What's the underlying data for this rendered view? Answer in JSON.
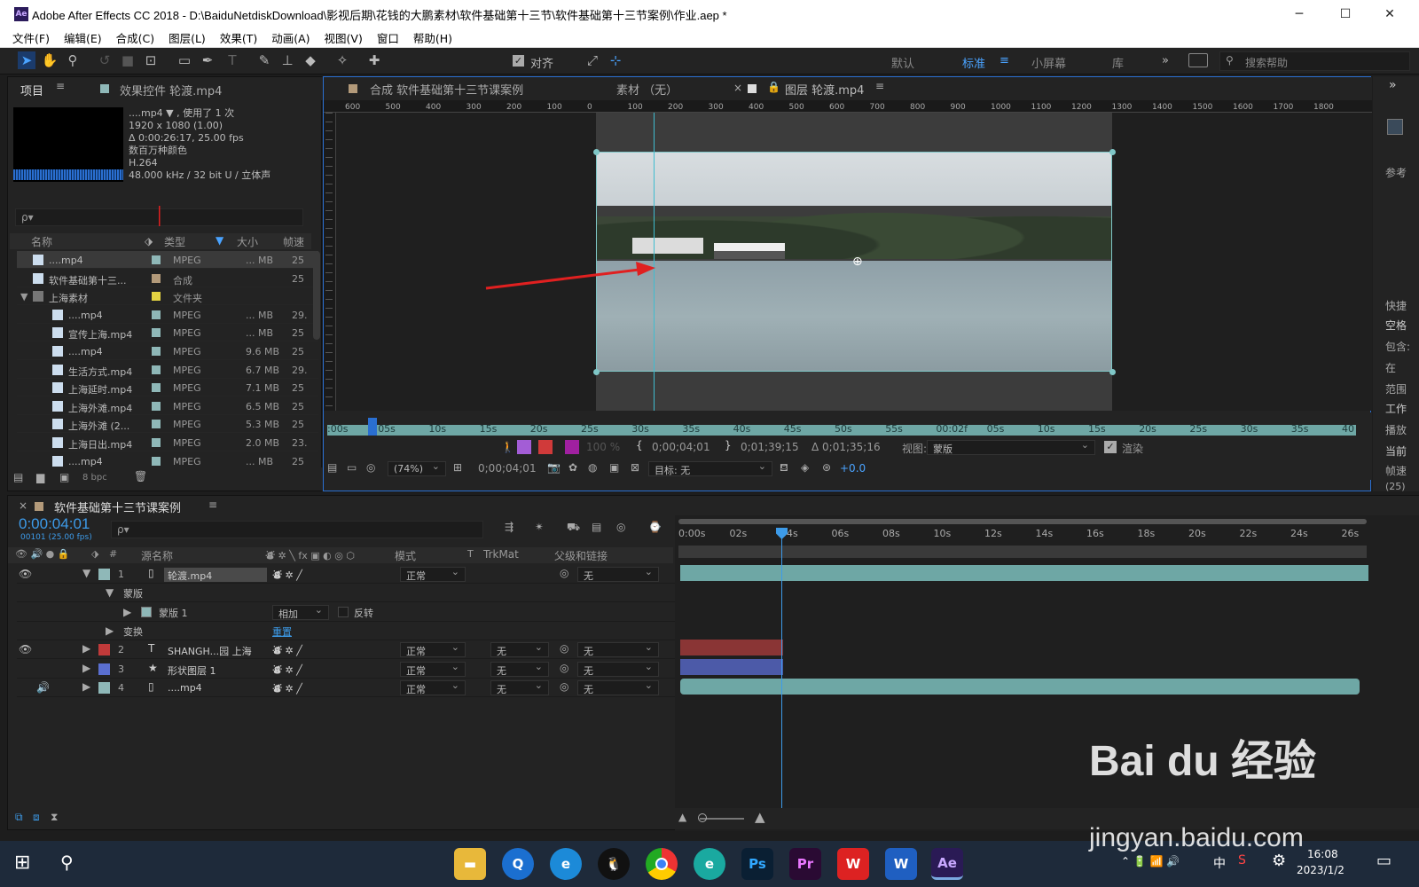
{
  "app": {
    "title": "Adobe After Effects CC 2018 - D:\\BaiduNetdiskDownload\\影视后期\\花钱的大鹏素材\\软件基础第十三节\\软件基础第十三节案例\\作业.aep *",
    "badge": "Ae",
    "win_min": "─",
    "win_max": "☐",
    "win_close": "✕"
  },
  "menu": [
    "文件(F)",
    "编辑(E)",
    "合成(C)",
    "图层(L)",
    "效果(T)",
    "动画(A)",
    "视图(V)",
    "窗口",
    "帮助(H)"
  ],
  "toolbar": {
    "align_label": "对齐",
    "workspaces": [
      "默认",
      "标准",
      "小屏幕",
      "库"
    ],
    "search_placeholder": "搜索帮助",
    "more": "»"
  },
  "project": {
    "tab": "项目",
    "effects_tab": "效果控件 轮渡.mp4",
    "info": {
      "name": "....mp4 ▼ , 使用了 1 次",
      "res": "1920 x 1080 (1.00)",
      "dur": "Δ 0:00:26:17, 25.00 fps",
      "colors": "数百万种颜色",
      "codec": "H.264",
      "audio": "48.000 kHz / 32 bit U / 立体声"
    },
    "search_placeholder": "ρ▾",
    "columns": [
      "名称",
      "类型",
      "大小",
      "帧速率"
    ],
    "bpc": "8 bpc",
    "items": [
      {
        "name": "....mp4",
        "type": "MPEG",
        "size": "... MB",
        "fps": "25",
        "color": "#8fb8b8",
        "indent": 0,
        "selected": true
      },
      {
        "name": "软件基础第十三...",
        "type": "合成",
        "size": "",
        "fps": "25",
        "color": "#b39a7a",
        "indent": 0
      },
      {
        "name": "上海素材",
        "type": "文件夹",
        "size": "",
        "fps": "",
        "color": "#e5d442",
        "indent": 0,
        "folder": true
      },
      {
        "name": "....mp4",
        "type": "MPEG",
        "size": "... MB",
        "fps": "29.",
        "color": "#8fb8b8",
        "indent": 1
      },
      {
        "name": "宣传上海.mp4",
        "type": "MPEG",
        "size": "... MB",
        "fps": "25",
        "color": "#8fb8b8",
        "indent": 1
      },
      {
        "name": "....mp4",
        "type": "MPEG",
        "size": "9.6 MB",
        "fps": "25",
        "color": "#8fb8b8",
        "indent": 1
      },
      {
        "name": "生活方式.mp4",
        "type": "MPEG",
        "size": "6.7 MB",
        "fps": "29.",
        "color": "#8fb8b8",
        "indent": 1
      },
      {
        "name": "上海延时.mp4",
        "type": "MPEG",
        "size": "7.1 MB",
        "fps": "25",
        "color": "#8fb8b8",
        "indent": 1
      },
      {
        "name": "上海外滩.mp4",
        "type": "MPEG",
        "size": "6.5 MB",
        "fps": "25",
        "color": "#8fb8b8",
        "indent": 1
      },
      {
        "name": "上海外滩 (2...",
        "type": "MPEG",
        "size": "5.3 MB",
        "fps": "25",
        "color": "#8fb8b8",
        "indent": 1
      },
      {
        "name": "上海日出.mp4",
        "type": "MPEG",
        "size": "2.0 MB",
        "fps": "23.",
        "color": "#8fb8b8",
        "indent": 1
      },
      {
        "name": "....mp4",
        "type": "MPEG",
        "size": "... MB",
        "fps": "25",
        "color": "#8fb8b8",
        "indent": 1
      }
    ]
  },
  "viewer": {
    "tabs": [
      "合成 软件基础第十三节课案例",
      "素材 （无）",
      "图层 轮渡.mp4"
    ],
    "ruler": [
      "600",
      "500",
      "400",
      "300",
      "200",
      "100",
      "0",
      "100",
      "200",
      "300",
      "400",
      "500",
      "600",
      "700",
      "800",
      "900",
      "1000",
      "1100",
      "1200",
      "1300",
      "1400",
      "1500",
      "1600",
      "1700",
      "1800"
    ],
    "scrub_ticks": [
      ":00s",
      "05s",
      "10s",
      "15s",
      "20s",
      "25s",
      "30s",
      "35s",
      "40s",
      "45s",
      "50s",
      "55s",
      "00:02f",
      "05s",
      "10s",
      "15s",
      "20s",
      "25s",
      "30s",
      "35s",
      "40"
    ],
    "in_point": "0;00;04;01",
    "out_point": "0;01;39;15",
    "duration": "Δ 0;01;35;16",
    "view_label": "视图:",
    "view_value": "蒙版",
    "render_label": "渲染",
    "zoom": "(74%)",
    "timecode": "0;00;04;01",
    "target": "目标: 无",
    "exposure": "+0.0",
    "pct": "100 %"
  },
  "right_panel": {
    "labels": [
      "参考",
      "快捷",
      "空格",
      "包含:",
      "在",
      "范围",
      "工作",
      "播放",
      "当前",
      "帧速",
      "(25)"
    ],
    "expand": "»"
  },
  "timeline": {
    "comp_tab": "软件基础第十三节课案例",
    "timecode": "0:00:04:01",
    "sub": "00101 (25.00 fps)",
    "search_placeholder": "ρ▾",
    "col_source": "源名称",
    "col_mode": "模式",
    "col_t": "T",
    "col_trkmat": "TrkMat",
    "col_parent": "父级和链接",
    "col_num": "#",
    "ticks": [
      "0:00s",
      "02s",
      "04s",
      "06s",
      "08s",
      "10s",
      "12s",
      "14s",
      "16s",
      "18s",
      "20s",
      "22s",
      "24s",
      "26s"
    ],
    "layers": [
      {
        "num": "1",
        "name": "轮渡.mp4",
        "mode": "正常",
        "trk": "",
        "parent": "无",
        "color": "#8fb8b8",
        "type": "video",
        "selected": true
      },
      {
        "num": "",
        "name": "蒙版",
        "sub": true
      },
      {
        "num": "",
        "name": "蒙版 1",
        "sub2": true,
        "mode": "相加",
        "invert": "反转"
      },
      {
        "num": "",
        "name": "变换",
        "sub": true,
        "reset": "重置"
      },
      {
        "num": "2",
        "name": "SHANGH...园 上海",
        "mode": "正常",
        "trk": "无",
        "parent": "无",
        "color": "#c03a3a",
        "type": "text"
      },
      {
        "num": "3",
        "name": "形状图层 1",
        "mode": "正常",
        "trk": "无",
        "parent": "无",
        "color": "#5a6fd0",
        "type": "shape"
      },
      {
        "num": "4",
        "name": "....mp4",
        "mode": "正常",
        "trk": "无",
        "parent": "无",
        "color": "#8fb8b8",
        "type": "video"
      }
    ]
  },
  "taskbar": {
    "time": "16:08",
    "date": "2023/1/2",
    "ime": "中",
    "apps": [
      "Ps",
      "Pr",
      "Ae"
    ]
  },
  "watermark": {
    "logo": "Bai du 经验",
    "url": "jingyan.baidu.com"
  }
}
